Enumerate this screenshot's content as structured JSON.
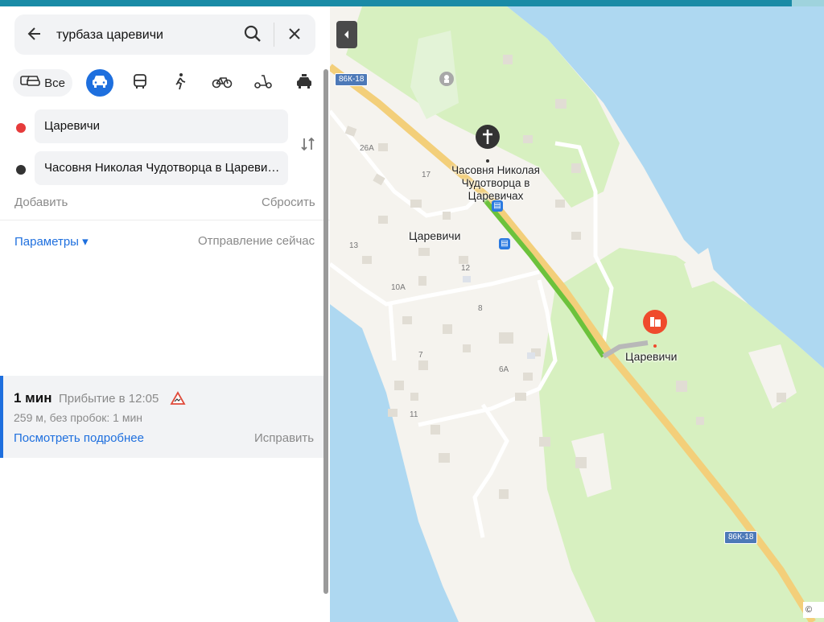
{
  "search": {
    "query": "турбаза царевичи"
  },
  "modes": {
    "all_label": "Все"
  },
  "waypoints": {
    "from": "Царевичи",
    "to": "Часовня Николая Чудотворца в Царевичах"
  },
  "actions": {
    "add": "Добавить",
    "reset": "Сбросить"
  },
  "options": {
    "params": "Параметры ▾",
    "departure": "Отправление сейчас"
  },
  "route": {
    "duration": "1 мин",
    "arrival": "Прибытие в 12:05",
    "details": "259 м, без пробок: 1 мин",
    "more_link": "Посмотреть подробнее",
    "fix_link": "Исправить"
  },
  "map": {
    "road_number": "86К-18",
    "village_label": "Царевичи",
    "chapel_label": "Часовня Николая Чудотворца в Царевичах",
    "destination_label": "Царевичи",
    "house_numbers": [
      "26А",
      "17",
      "13",
      "12",
      "10А",
      "8",
      "7",
      "6А",
      "11"
    ],
    "copyright": "© Ян"
  },
  "colors": {
    "accent": "#1e6fde",
    "route_green": "#6cc23c",
    "water": "#aed8f1",
    "land": "#f5f3ee",
    "forest": "#d7f0c0",
    "road": "#f3cf7a",
    "start_dot": "#e63b3b",
    "end_dot": "#333333",
    "poi_red": "#ef4b2d"
  }
}
